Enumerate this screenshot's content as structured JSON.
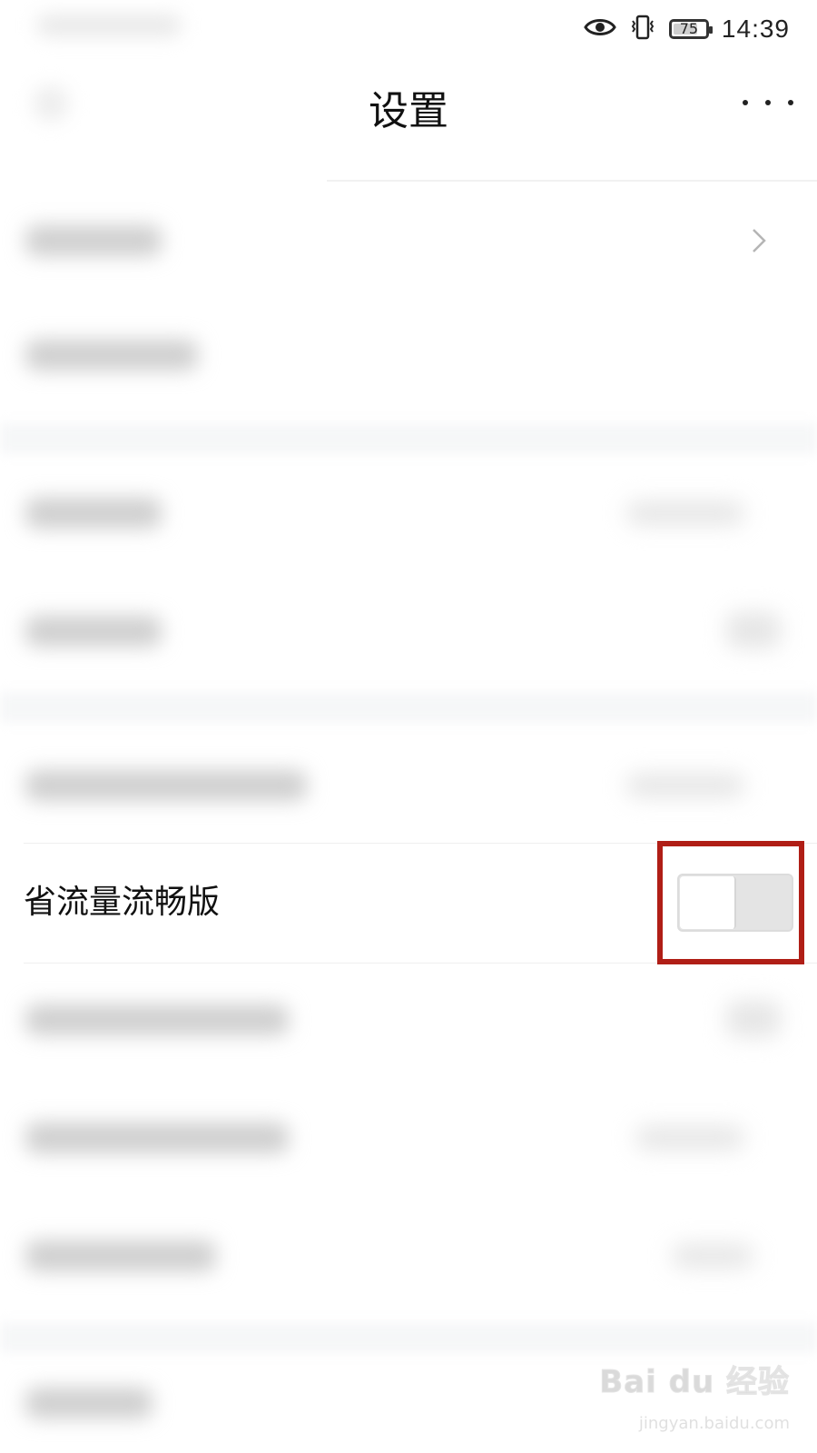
{
  "status_bar": {
    "icons": [
      "eye-icon",
      "vibrate-icon",
      "battery-icon"
    ],
    "battery_level": "75",
    "battery_fraction": 0.75,
    "time": "14:39"
  },
  "nav": {
    "title": "设置",
    "back_icon": "back-arrow-icon",
    "more_icon": "more-dots-icon"
  },
  "settings": {
    "data_saver": {
      "label": "省流量流畅版",
      "toggle_on": false
    }
  },
  "colors": {
    "highlight": "#b01e16",
    "toggle_track": "#e4e4e4",
    "background": "#ffffff"
  },
  "watermark": {
    "logo": "Bai du 经验",
    "url": "jingyan.baidu.com"
  }
}
